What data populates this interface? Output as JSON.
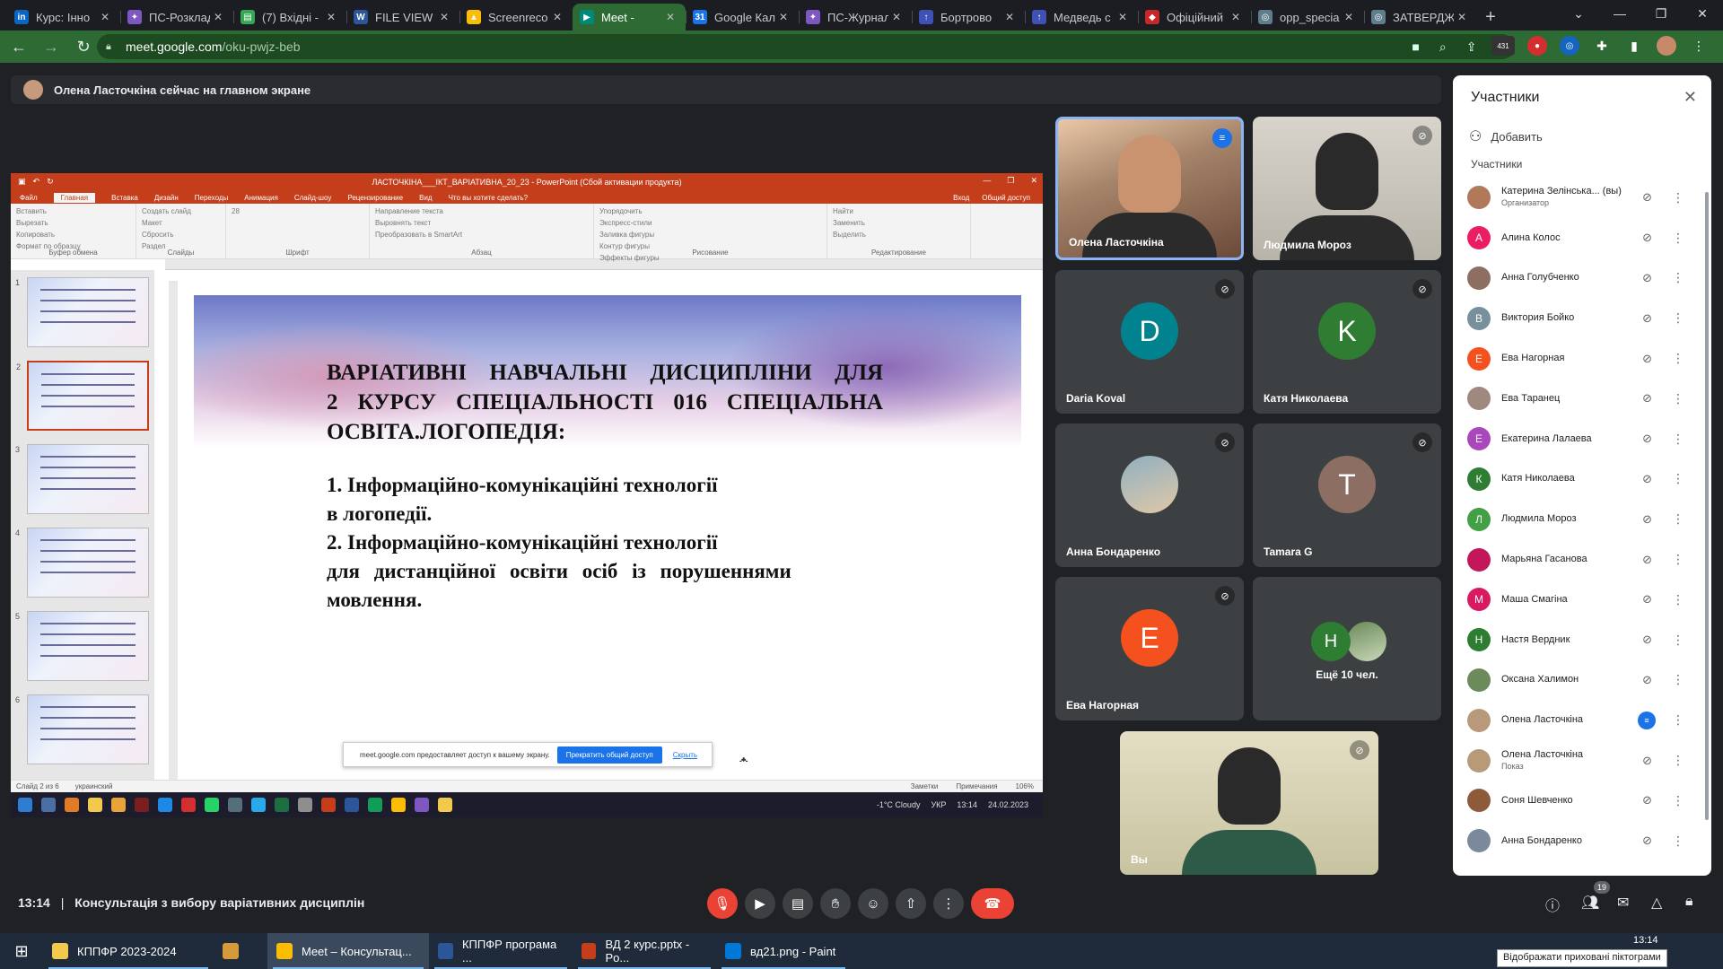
{
  "browser": {
    "tabs": [
      {
        "label": "Курс: Інно",
        "icon": "linkedin-icon",
        "color": "#0a66c2",
        "glyph": "in"
      },
      {
        "label": "ПС-Розклад",
        "icon": "wand-icon",
        "color": "#7e57c2",
        "glyph": "✦"
      },
      {
        "label": "(7) Вхідні -",
        "icon": "sheet-icon",
        "color": "#34a853",
        "glyph": "▤"
      },
      {
        "label": "FILE VIEW",
        "icon": "word-icon",
        "color": "#2b579a",
        "glyph": "W"
      },
      {
        "label": "Screenreco",
        "icon": "drive-icon",
        "color": "#fbbc04",
        "glyph": "▲"
      },
      {
        "label": "Meet -",
        "icon": "meet-icon",
        "color": "#00897b",
        "glyph": "▶",
        "active": true
      },
      {
        "label": "Google Кал",
        "icon": "calendar-icon",
        "color": "#1a73e8",
        "glyph": "31"
      },
      {
        "label": "ПС-Журнал",
        "icon": "wand-icon",
        "color": "#7e57c2",
        "glyph": "✦"
      },
      {
        "label": "Бортрово",
        "icon": "upload-icon",
        "color": "#3f51b5",
        "glyph": "↑"
      },
      {
        "label": "Медведь с",
        "icon": "upload-icon",
        "color": "#3f51b5",
        "glyph": "↑"
      },
      {
        "label": "Офіційний",
        "icon": "shield-icon",
        "color": "#c62828",
        "glyph": "◆"
      },
      {
        "label": "opp_specia",
        "icon": "globe-icon",
        "color": "#607d8b",
        "glyph": "◎"
      },
      {
        "label": "ЗАТВЕРДЖ",
        "icon": "globe-icon",
        "color": "#607d8b",
        "glyph": "◎"
      }
    ],
    "url_host": "meet.google.com",
    "url_path": "/oku-pwjz-beb",
    "ext_badge": "431"
  },
  "meet": {
    "presenting_banner": "Олена Ласточкіна сейчас на главном экране",
    "time": "13:14",
    "meeting_title": "Консультація з вибору варіативних дисциплін",
    "participant_count": "19"
  },
  "ppt": {
    "window_title": "ЛАСТОЧКІНА___ІКТ_ВАРІАТИВНА_20_23 - PowerPoint (Сбой активации продукта)",
    "menu": [
      "Файл",
      "Главная",
      "Вставка",
      "Дизайн",
      "Переходы",
      "Анимация",
      "Слайд-шоу",
      "Рецензирование",
      "Вид",
      "Что вы хотите сделать?"
    ],
    "menu_right": [
      "Вход",
      "Общий доступ"
    ],
    "ribbon_groups": [
      {
        "label": "Буфер обмена",
        "items": [
          "Вставить",
          "Вырезать",
          "Копировать",
          "Формат по образцу"
        ]
      },
      {
        "label": "Слайды",
        "items": [
          "Создать слайд",
          "Макет",
          "Сбросить",
          "Раздел"
        ]
      },
      {
        "label": "Шрифт",
        "items": [
          "28"
        ]
      },
      {
        "label": "Абзац",
        "items": [
          "Направление текста",
          "Выровнять текст",
          "Преобразовать в SmartArt"
        ]
      },
      {
        "label": "Рисование",
        "items": [
          "Упорядочить",
          "Экспресс-стили",
          "Заливка фигуры",
          "Контур фигуры",
          "Эффекты фигуры"
        ]
      },
      {
        "label": "Редактирование",
        "items": [
          "Найти",
          "Заменить",
          "Выделить"
        ]
      }
    ],
    "slide_numbers": [
      "1",
      "2",
      "3",
      "4",
      "5",
      "6"
    ],
    "slide": {
      "heading_lines": [
        "ВАРІАТИВНІ НАВЧАЛЬНІ ДИСЦИПЛІНИ ДЛЯ",
        "2 КУРСУ СПЕЦІАЛЬНОСТІ 016 СПЕЦІАЛЬНА",
        "ОСВІТА.ЛОГОПЕДІЯ:"
      ],
      "item_lines": [
        "1. Інформаційно-комунікаційні технології",
        "в логопедії.",
        "2. Інформаційно-комунікаційні технології",
        "для дистанційної освіти осіб із порушеннями",
        "мовлення."
      ]
    },
    "share_notice": "meet.google.com предоставляет доступ к вашему экрану.",
    "share_stop": "Прекратить общий доступ",
    "share_hide": "Скрыть",
    "status_left": [
      "Слайд 2 из 6",
      "украинский"
    ],
    "status_right": [
      "Заметки",
      "Примечания",
      "106%"
    ],
    "tray_weather": "-1°C Cloudy",
    "tray_lang": "УКР",
    "tray_time": "13:14",
    "tray_date": "24.02.2023"
  },
  "tiles": [
    {
      "name": "Олена Ласточкіна",
      "type": "video",
      "speaking": true
    },
    {
      "name": "Людмила Мороз",
      "type": "video"
    },
    {
      "name": "Daria Koval",
      "letter": "D",
      "color": "#00838f"
    },
    {
      "name": "Катя Николаева",
      "letter": "K",
      "color": "#2e7d32"
    },
    {
      "name": "Анна Бондаренко",
      "type": "photo"
    },
    {
      "name": "Tamara G",
      "letter": "T",
      "color": "#8d6e63"
    },
    {
      "name": "Ева Нагорная",
      "letter": "E",
      "color": "#f4511e"
    },
    {
      "name": "Ещё 10 чел.",
      "letter": "H",
      "color": "#2e7d32"
    },
    {
      "name": "Вы",
      "type": "video"
    }
  ],
  "panel": {
    "title": "Участники",
    "add_label": "Добавить",
    "section_label": "Участники",
    "participants": [
      {
        "name": "Катерина Зелінська... (вы)",
        "sub": "Организатор",
        "letter": "",
        "color": "#b07a5a"
      },
      {
        "name": "Алина Колос",
        "sub": "",
        "letter": "А",
        "color": "#e91e63"
      },
      {
        "name": "Анна Голубченко",
        "sub": "",
        "letter": "",
        "color": "#8d6e63"
      },
      {
        "name": "Виктория Бойко",
        "sub": "",
        "letter": "В",
        "color": "#78909c"
      },
      {
        "name": "Ева Нагорная",
        "sub": "",
        "letter": "Е",
        "color": "#f4511e"
      },
      {
        "name": "Ева Таранец",
        "sub": "",
        "letter": "",
        "color": "#a1887f"
      },
      {
        "name": "Екатерина Лалаева",
        "sub": "",
        "letter": "Е",
        "color": "#ab47bc"
      },
      {
        "name": "Катя Николаева",
        "sub": "",
        "letter": "К",
        "color": "#2e7d32"
      },
      {
        "name": "Людмила Мороз",
        "sub": "",
        "letter": "Л",
        "color": "#43a047"
      },
      {
        "name": "Марьяна Гасанова",
        "sub": "",
        "letter": "",
        "color": "#c2185b"
      },
      {
        "name": "Маша Смагіна",
        "sub": "",
        "letter": "М",
        "color": "#d81b60"
      },
      {
        "name": "Настя Вердник",
        "sub": "",
        "letter": "Н",
        "color": "#2e7d32"
      },
      {
        "name": "Оксана Халимон",
        "sub": "",
        "letter": "",
        "color": "#6d8b5a"
      },
      {
        "name": "Олена Ласточкіна",
        "sub": "",
        "letter": "",
        "color": "#b89a7a",
        "speaking": true
      },
      {
        "name": "Олена Ласточкіна",
        "sub": "Показ",
        "letter": "",
        "color": "#b89a7a"
      },
      {
        "name": "Соня Шевченко",
        "sub": "",
        "letter": "",
        "color": "#8d5a3a"
      },
      {
        "name": "Анна Бондаренко",
        "sub": "",
        "letter": "",
        "color": "#7b8a9a"
      }
    ]
  },
  "windows_taskbar": {
    "items": [
      "КППФР 2023-2024",
      "",
      "Meet – Консультац...",
      "КППФР програма ...",
      "ВД 2 курс.pptx - Po...",
      "вд21.png - Paint"
    ],
    "tooltip": "Відображати приховані піктограми",
    "time": "13:14"
  }
}
